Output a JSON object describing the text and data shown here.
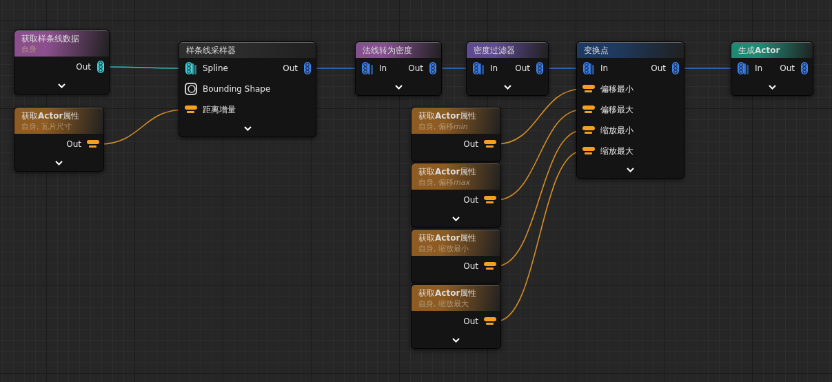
{
  "nodes": [
    {
      "title": "获取样条线数据",
      "subtitle": "自身",
      "color": "#8c4f8e",
      "rows": [
        {
          "output": {
            "label": "Out",
            "kind": "spline"
          }
        }
      ]
    },
    {
      "title": "获取**Actor**属性",
      "subtitle": "自身, 瓦片尺寸",
      "color": "#8e5c22",
      "rows": [
        {
          "output": {
            "label": "Out",
            "kind": "attribute"
          }
        }
      ]
    },
    {
      "title": "样条线采样器",
      "color": "#2e2e2e",
      "rows": [
        {
          "input": {
            "label": "Spline",
            "kind": "spline"
          },
          "output": {
            "label": "Out",
            "kind": "point"
          }
        },
        {
          "input": {
            "label": "Bounding Shape",
            "kind": "shape"
          }
        },
        {
          "input": {
            "label": "距离增量",
            "kind": "attribute"
          }
        }
      ]
    },
    {
      "title": "法线转为密度",
      "color": "#84508e",
      "rows": [
        {
          "input": {
            "label": "In",
            "kind": "point"
          },
          "output": {
            "label": "Out",
            "kind": "point"
          }
        }
      ]
    },
    {
      "title": "密度过滤器",
      "color": "#5e4a90",
      "rows": [
        {
          "input": {
            "label": "In",
            "kind": "point"
          },
          "output": {
            "label": "Out",
            "kind": "point"
          }
        }
      ]
    },
    {
      "title": "变换点",
      "color": "#1f3a60",
      "rows": [
        {
          "input": {
            "label": "In",
            "kind": "point"
          },
          "output": {
            "label": "Out",
            "kind": "point"
          }
        },
        {
          "input": {
            "label": "偏移最小",
            "kind": "attribute"
          }
        },
        {
          "input": {
            "label": "偏移最大",
            "kind": "attribute"
          }
        },
        {
          "input": {
            "label": "缩放最小",
            "kind": "attribute"
          }
        },
        {
          "input": {
            "label": "缩放最大",
            "kind": "attribute"
          }
        }
      ]
    },
    {
      "title": "生成**Actor**",
      "color": "#1e8a73",
      "rows": [
        {
          "input": {
            "label": "In",
            "kind": "point"
          },
          "output": {
            "label": "Out",
            "kind": "point"
          }
        }
      ]
    },
    {
      "title": "获取**Actor**属性",
      "subtitle": [
        {
          "text": "自身, 偏移",
          "italic": false
        },
        {
          "text": "min",
          "italic": true
        }
      ],
      "color": "#8e5c22",
      "rows": [
        {
          "output": {
            "label": "Out",
            "kind": "attribute"
          }
        }
      ]
    },
    {
      "title": "获取**Actor**属性",
      "subtitle": [
        {
          "text": "自身, 偏移",
          "italic": false
        },
        {
          "text": "max",
          "italic": true
        }
      ],
      "color": "#8e5c22",
      "rows": [
        {
          "output": {
            "label": "Out",
            "kind": "attribute"
          }
        }
      ]
    },
    {
      "title": "获取**Actor**属性",
      "subtitle": "自身, 缩放最小",
      "color": "#8e5c22",
      "rows": [
        {
          "output": {
            "label": "Out",
            "kind": "attribute"
          }
        }
      ]
    },
    {
      "title": "获取**Actor**属性",
      "subtitle": "自身, 缩放最大",
      "color": "#8e5c22",
      "rows": [
        {
          "output": {
            "label": "Out",
            "kind": "attribute"
          }
        }
      ]
    }
  ]
}
